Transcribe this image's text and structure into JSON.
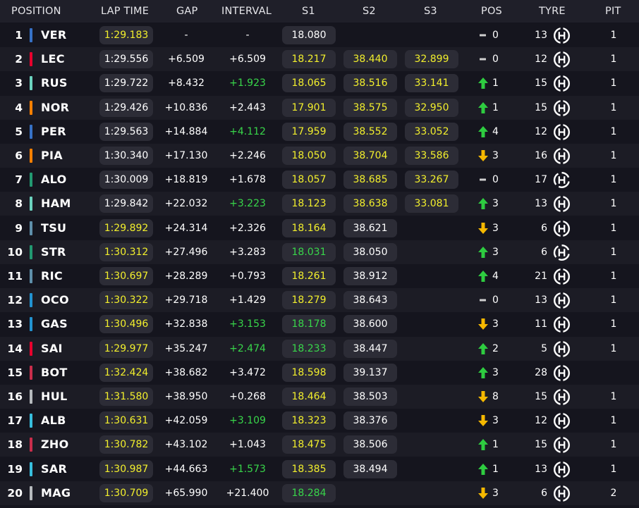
{
  "colors": {
    "yellow": "#f2ef2c",
    "green": "#38d64a",
    "white": "#ffffff",
    "up": "#2ecc40",
    "down": "#f5b800",
    "same": "#cfcfcf"
  },
  "header": {
    "position": "POSITION",
    "lap_time": "LAP TIME",
    "gap": "GAP",
    "interval": "INTERVAL",
    "s1": "S1",
    "s2": "S2",
    "s3": "S3",
    "pos": "POS",
    "tyre": "TYRE",
    "pit": "PIT"
  },
  "rows": [
    {
      "pos": "1",
      "driver": "VER",
      "team_color": "#3671c6",
      "lap": "1:29.183",
      "lap_c": "yellow",
      "gap": "-",
      "int": "-",
      "int_c": "white",
      "s1": "18.080",
      "s1_c": "white",
      "s2": "",
      "s2_c": "white",
      "s3": "",
      "s3_c": "white",
      "chg_dir": "same",
      "chg": "0",
      "age": "13",
      "tyre_icon": "hard-tyre-icon",
      "pit": "1"
    },
    {
      "pos": "2",
      "driver": "LEC",
      "team_color": "#e8002d",
      "lap": "1:29.556",
      "lap_c": "white",
      "gap": "+6.509",
      "int": "+6.509",
      "int_c": "white",
      "s1": "18.217",
      "s1_c": "yellow",
      "s2": "38.440",
      "s2_c": "yellow",
      "s3": "32.899",
      "s3_c": "yellow",
      "chg_dir": "same",
      "chg": "0",
      "age": "12",
      "tyre_icon": "hard-tyre-icon",
      "pit": "1"
    },
    {
      "pos": "3",
      "driver": "RUS",
      "team_color": "#6cd3bf",
      "lap": "1:29.722",
      "lap_c": "white",
      "gap": "+8.432",
      "int": "+1.923",
      "int_c": "green",
      "s1": "18.065",
      "s1_c": "yellow",
      "s2": "38.516",
      "s2_c": "yellow",
      "s3": "33.141",
      "s3_c": "yellow",
      "chg_dir": "up",
      "chg": "1",
      "age": "15",
      "tyre_icon": "hard-tyre-icon",
      "pit": "1"
    },
    {
      "pos": "4",
      "driver": "NOR",
      "team_color": "#ff8000",
      "lap": "1:29.426",
      "lap_c": "white",
      "gap": "+10.836",
      "int": "+2.443",
      "int_c": "white",
      "s1": "17.901",
      "s1_c": "yellow",
      "s2": "38.575",
      "s2_c": "yellow",
      "s3": "32.950",
      "s3_c": "yellow",
      "chg_dir": "up",
      "chg": "1",
      "age": "15",
      "tyre_icon": "hard-tyre-icon",
      "pit": "1"
    },
    {
      "pos": "5",
      "driver": "PER",
      "team_color": "#3671c6",
      "lap": "1:29.563",
      "lap_c": "white",
      "gap": "+14.884",
      "int": "+4.112",
      "int_c": "green",
      "s1": "17.959",
      "s1_c": "yellow",
      "s2": "38.552",
      "s2_c": "yellow",
      "s3": "33.052",
      "s3_c": "yellow",
      "chg_dir": "up",
      "chg": "4",
      "age": "12",
      "tyre_icon": "hard-tyre-icon",
      "pit": "1"
    },
    {
      "pos": "6",
      "driver": "PIA",
      "team_color": "#ff8000",
      "lap": "1:30.340",
      "lap_c": "white",
      "gap": "+17.130",
      "int": "+2.246",
      "int_c": "white",
      "s1": "18.050",
      "s1_c": "yellow",
      "s2": "38.704",
      "s2_c": "yellow",
      "s3": "33.586",
      "s3_c": "yellow",
      "chg_dir": "down",
      "chg": "3",
      "age": "16",
      "tyre_icon": "hard-tyre-icon",
      "pit": "1"
    },
    {
      "pos": "7",
      "driver": "ALO",
      "team_color": "#229971",
      "lap": "1:30.009",
      "lap_c": "white",
      "gap": "+18.819",
      "int": "+1.678",
      "int_c": "white",
      "s1": "18.057",
      "s1_c": "yellow",
      "s2": "38.685",
      "s2_c": "yellow",
      "s3": "33.267",
      "s3_c": "yellow",
      "chg_dir": "same",
      "chg": "0",
      "age": "17",
      "tyre_icon": "used-hard-tyre-icon",
      "pit": "1"
    },
    {
      "pos": "8",
      "driver": "HAM",
      "team_color": "#6cd3bf",
      "lap": "1:29.842",
      "lap_c": "white",
      "gap": "+22.032",
      "int": "+3.223",
      "int_c": "green",
      "s1": "18.123",
      "s1_c": "yellow",
      "s2": "38.638",
      "s2_c": "yellow",
      "s3": "33.081",
      "s3_c": "yellow",
      "chg_dir": "up",
      "chg": "3",
      "age": "13",
      "tyre_icon": "hard-tyre-icon",
      "pit": "1"
    },
    {
      "pos": "9",
      "driver": "TSU",
      "team_color": "#5e8faa",
      "lap": "1:29.892",
      "lap_c": "yellow",
      "gap": "+24.314",
      "int": "+2.326",
      "int_c": "white",
      "s1": "18.164",
      "s1_c": "yellow",
      "s2": "38.621",
      "s2_c": "white",
      "s3": "",
      "s3_c": "white",
      "chg_dir": "down",
      "chg": "3",
      "age": "6",
      "tyre_icon": "hard-tyre-icon",
      "pit": "1"
    },
    {
      "pos": "10",
      "driver": "STR",
      "team_color": "#229971",
      "lap": "1:30.312",
      "lap_c": "yellow",
      "gap": "+27.496",
      "int": "+3.283",
      "int_c": "white",
      "s1": "18.031",
      "s1_c": "green",
      "s2": "38.050",
      "s2_c": "white",
      "s3": "",
      "s3_c": "white",
      "chg_dir": "up",
      "chg": "3",
      "age": "6",
      "tyre_icon": "used-hard-tyre-icon",
      "pit": "1"
    },
    {
      "pos": "11",
      "driver": "RIC",
      "team_color": "#5e8faa",
      "lap": "1:30.697",
      "lap_c": "yellow",
      "gap": "+28.289",
      "int": "+0.793",
      "int_c": "white",
      "s1": "18.261",
      "s1_c": "yellow",
      "s2": "38.912",
      "s2_c": "white",
      "s3": "",
      "s3_c": "white",
      "chg_dir": "up",
      "chg": "4",
      "age": "21",
      "tyre_icon": "hard-tyre-icon",
      "pit": "1"
    },
    {
      "pos": "12",
      "driver": "OCO",
      "team_color": "#2293d1",
      "lap": "1:30.322",
      "lap_c": "yellow",
      "gap": "+29.718",
      "int": "+1.429",
      "int_c": "white",
      "s1": "18.279",
      "s1_c": "yellow",
      "s2": "38.643",
      "s2_c": "white",
      "s3": "",
      "s3_c": "white",
      "chg_dir": "same",
      "chg": "0",
      "age": "13",
      "tyre_icon": "hard-tyre-icon",
      "pit": "1"
    },
    {
      "pos": "13",
      "driver": "GAS",
      "team_color": "#2293d1",
      "lap": "1:30.496",
      "lap_c": "yellow",
      "gap": "+32.838",
      "int": "+3.153",
      "int_c": "green",
      "s1": "18.178",
      "s1_c": "green",
      "s2": "38.600",
      "s2_c": "white",
      "s3": "",
      "s3_c": "white",
      "chg_dir": "down",
      "chg": "3",
      "age": "11",
      "tyre_icon": "hard-tyre-icon",
      "pit": "1"
    },
    {
      "pos": "14",
      "driver": "SAI",
      "team_color": "#e8002d",
      "lap": "1:29.977",
      "lap_c": "yellow",
      "gap": "+35.247",
      "int": "+2.474",
      "int_c": "green",
      "s1": "18.233",
      "s1_c": "green",
      "s2": "38.447",
      "s2_c": "white",
      "s3": "",
      "s3_c": "white",
      "chg_dir": "up",
      "chg": "2",
      "age": "5",
      "tyre_icon": "hard-tyre-icon",
      "pit": "1"
    },
    {
      "pos": "15",
      "driver": "BOT",
      "team_color": "#c92d4b",
      "lap": "1:32.424",
      "lap_c": "yellow",
      "gap": "+38.682",
      "int": "+3.472",
      "int_c": "white",
      "s1": "18.598",
      "s1_c": "yellow",
      "s2": "39.137",
      "s2_c": "white",
      "s3": "",
      "s3_c": "white",
      "chg_dir": "up",
      "chg": "3",
      "age": "28",
      "tyre_icon": "hard-tyre-icon",
      "pit": ""
    },
    {
      "pos": "16",
      "driver": "HUL",
      "team_color": "#b6babd",
      "lap": "1:31.580",
      "lap_c": "yellow",
      "gap": "+38.950",
      "int": "+0.268",
      "int_c": "white",
      "s1": "18.464",
      "s1_c": "yellow",
      "s2": "38.503",
      "s2_c": "white",
      "s3": "",
      "s3_c": "white",
      "chg_dir": "down",
      "chg": "8",
      "age": "15",
      "tyre_icon": "hard-tyre-icon",
      "pit": "1"
    },
    {
      "pos": "17",
      "driver": "ALB",
      "team_color": "#37bedd",
      "lap": "1:30.631",
      "lap_c": "yellow",
      "gap": "+42.059",
      "int": "+3.109",
      "int_c": "green",
      "s1": "18.323",
      "s1_c": "yellow",
      "s2": "38.376",
      "s2_c": "white",
      "s3": "",
      "s3_c": "white",
      "chg_dir": "down",
      "chg": "3",
      "age": "12",
      "tyre_icon": "hard-tyre-icon",
      "pit": "1"
    },
    {
      "pos": "18",
      "driver": "ZHO",
      "team_color": "#c92d4b",
      "lap": "1:30.782",
      "lap_c": "yellow",
      "gap": "+43.102",
      "int": "+1.043",
      "int_c": "white",
      "s1": "18.475",
      "s1_c": "yellow",
      "s2": "38.506",
      "s2_c": "white",
      "s3": "",
      "s3_c": "white",
      "chg_dir": "up",
      "chg": "1",
      "age": "15",
      "tyre_icon": "hard-tyre-icon",
      "pit": "1"
    },
    {
      "pos": "19",
      "driver": "SAR",
      "team_color": "#37bedd",
      "lap": "1:30.987",
      "lap_c": "yellow",
      "gap": "+44.663",
      "int": "+1.573",
      "int_c": "green",
      "s1": "18.385",
      "s1_c": "yellow",
      "s2": "38.494",
      "s2_c": "white",
      "s3": "",
      "s3_c": "white",
      "chg_dir": "up",
      "chg": "1",
      "age": "13",
      "tyre_icon": "hard-tyre-icon",
      "pit": "1"
    },
    {
      "pos": "20",
      "driver": "MAG",
      "team_color": "#b6babd",
      "lap": "1:30.709",
      "lap_c": "yellow",
      "gap": "+65.990",
      "int": "+21.400",
      "int_c": "white",
      "s1": "18.284",
      "s1_c": "green",
      "s2": "",
      "s2_c": "white",
      "s3": "",
      "s3_c": "white",
      "chg_dir": "down",
      "chg": "3",
      "age": "6",
      "tyre_icon": "hard-tyre-icon",
      "pit": "2"
    }
  ]
}
